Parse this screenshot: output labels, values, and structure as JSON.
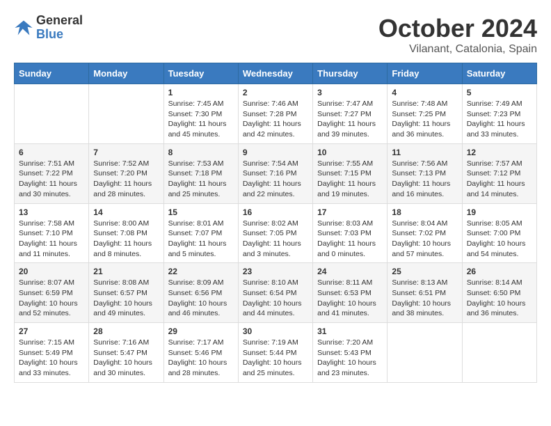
{
  "header": {
    "logo_general": "General",
    "logo_blue": "Blue",
    "month_title": "October 2024",
    "subtitle": "Vilanant, Catalonia, Spain"
  },
  "weekdays": [
    "Sunday",
    "Monday",
    "Tuesday",
    "Wednesday",
    "Thursday",
    "Friday",
    "Saturday"
  ],
  "weeks": [
    [
      {
        "day": "",
        "info": ""
      },
      {
        "day": "",
        "info": ""
      },
      {
        "day": "1",
        "info": "Sunrise: 7:45 AM\nSunset: 7:30 PM\nDaylight: 11 hours and 45 minutes."
      },
      {
        "day": "2",
        "info": "Sunrise: 7:46 AM\nSunset: 7:28 PM\nDaylight: 11 hours and 42 minutes."
      },
      {
        "day": "3",
        "info": "Sunrise: 7:47 AM\nSunset: 7:27 PM\nDaylight: 11 hours and 39 minutes."
      },
      {
        "day": "4",
        "info": "Sunrise: 7:48 AM\nSunset: 7:25 PM\nDaylight: 11 hours and 36 minutes."
      },
      {
        "day": "5",
        "info": "Sunrise: 7:49 AM\nSunset: 7:23 PM\nDaylight: 11 hours and 33 minutes."
      }
    ],
    [
      {
        "day": "6",
        "info": "Sunrise: 7:51 AM\nSunset: 7:22 PM\nDaylight: 11 hours and 30 minutes."
      },
      {
        "day": "7",
        "info": "Sunrise: 7:52 AM\nSunset: 7:20 PM\nDaylight: 11 hours and 28 minutes."
      },
      {
        "day": "8",
        "info": "Sunrise: 7:53 AM\nSunset: 7:18 PM\nDaylight: 11 hours and 25 minutes."
      },
      {
        "day": "9",
        "info": "Sunrise: 7:54 AM\nSunset: 7:16 PM\nDaylight: 11 hours and 22 minutes."
      },
      {
        "day": "10",
        "info": "Sunrise: 7:55 AM\nSunset: 7:15 PM\nDaylight: 11 hours and 19 minutes."
      },
      {
        "day": "11",
        "info": "Sunrise: 7:56 AM\nSunset: 7:13 PM\nDaylight: 11 hours and 16 minutes."
      },
      {
        "day": "12",
        "info": "Sunrise: 7:57 AM\nSunset: 7:12 PM\nDaylight: 11 hours and 14 minutes."
      }
    ],
    [
      {
        "day": "13",
        "info": "Sunrise: 7:58 AM\nSunset: 7:10 PM\nDaylight: 11 hours and 11 minutes."
      },
      {
        "day": "14",
        "info": "Sunrise: 8:00 AM\nSunset: 7:08 PM\nDaylight: 11 hours and 8 minutes."
      },
      {
        "day": "15",
        "info": "Sunrise: 8:01 AM\nSunset: 7:07 PM\nDaylight: 11 hours and 5 minutes."
      },
      {
        "day": "16",
        "info": "Sunrise: 8:02 AM\nSunset: 7:05 PM\nDaylight: 11 hours and 3 minutes."
      },
      {
        "day": "17",
        "info": "Sunrise: 8:03 AM\nSunset: 7:03 PM\nDaylight: 11 hours and 0 minutes."
      },
      {
        "day": "18",
        "info": "Sunrise: 8:04 AM\nSunset: 7:02 PM\nDaylight: 10 hours and 57 minutes."
      },
      {
        "day": "19",
        "info": "Sunrise: 8:05 AM\nSunset: 7:00 PM\nDaylight: 10 hours and 54 minutes."
      }
    ],
    [
      {
        "day": "20",
        "info": "Sunrise: 8:07 AM\nSunset: 6:59 PM\nDaylight: 10 hours and 52 minutes."
      },
      {
        "day": "21",
        "info": "Sunrise: 8:08 AM\nSunset: 6:57 PM\nDaylight: 10 hours and 49 minutes."
      },
      {
        "day": "22",
        "info": "Sunrise: 8:09 AM\nSunset: 6:56 PM\nDaylight: 10 hours and 46 minutes."
      },
      {
        "day": "23",
        "info": "Sunrise: 8:10 AM\nSunset: 6:54 PM\nDaylight: 10 hours and 44 minutes."
      },
      {
        "day": "24",
        "info": "Sunrise: 8:11 AM\nSunset: 6:53 PM\nDaylight: 10 hours and 41 minutes."
      },
      {
        "day": "25",
        "info": "Sunrise: 8:13 AM\nSunset: 6:51 PM\nDaylight: 10 hours and 38 minutes."
      },
      {
        "day": "26",
        "info": "Sunrise: 8:14 AM\nSunset: 6:50 PM\nDaylight: 10 hours and 36 minutes."
      }
    ],
    [
      {
        "day": "27",
        "info": "Sunrise: 7:15 AM\nSunset: 5:49 PM\nDaylight: 10 hours and 33 minutes."
      },
      {
        "day": "28",
        "info": "Sunrise: 7:16 AM\nSunset: 5:47 PM\nDaylight: 10 hours and 30 minutes."
      },
      {
        "day": "29",
        "info": "Sunrise: 7:17 AM\nSunset: 5:46 PM\nDaylight: 10 hours and 28 minutes."
      },
      {
        "day": "30",
        "info": "Sunrise: 7:19 AM\nSunset: 5:44 PM\nDaylight: 10 hours and 25 minutes."
      },
      {
        "day": "31",
        "info": "Sunrise: 7:20 AM\nSunset: 5:43 PM\nDaylight: 10 hours and 23 minutes."
      },
      {
        "day": "",
        "info": ""
      },
      {
        "day": "",
        "info": ""
      }
    ]
  ]
}
